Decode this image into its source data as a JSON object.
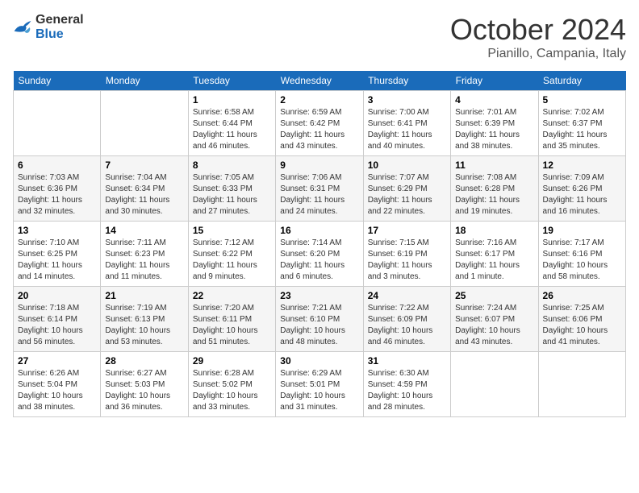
{
  "header": {
    "logo": {
      "general": "General",
      "blue": "Blue"
    },
    "title": "October 2024",
    "location": "Pianillo, Campania, Italy"
  },
  "calendar": {
    "weekdays": [
      "Sunday",
      "Monday",
      "Tuesday",
      "Wednesday",
      "Thursday",
      "Friday",
      "Saturday"
    ],
    "weeks": [
      [
        {
          "day": null
        },
        {
          "day": null
        },
        {
          "day": "1",
          "sunrise": "Sunrise: 6:58 AM",
          "sunset": "Sunset: 6:44 PM",
          "daylight": "Daylight: 11 hours and 46 minutes."
        },
        {
          "day": "2",
          "sunrise": "Sunrise: 6:59 AM",
          "sunset": "Sunset: 6:42 PM",
          "daylight": "Daylight: 11 hours and 43 minutes."
        },
        {
          "day": "3",
          "sunrise": "Sunrise: 7:00 AM",
          "sunset": "Sunset: 6:41 PM",
          "daylight": "Daylight: 11 hours and 40 minutes."
        },
        {
          "day": "4",
          "sunrise": "Sunrise: 7:01 AM",
          "sunset": "Sunset: 6:39 PM",
          "daylight": "Daylight: 11 hours and 38 minutes."
        },
        {
          "day": "5",
          "sunrise": "Sunrise: 7:02 AM",
          "sunset": "Sunset: 6:37 PM",
          "daylight": "Daylight: 11 hours and 35 minutes."
        }
      ],
      [
        {
          "day": "6",
          "sunrise": "Sunrise: 7:03 AM",
          "sunset": "Sunset: 6:36 PM",
          "daylight": "Daylight: 11 hours and 32 minutes."
        },
        {
          "day": "7",
          "sunrise": "Sunrise: 7:04 AM",
          "sunset": "Sunset: 6:34 PM",
          "daylight": "Daylight: 11 hours and 30 minutes."
        },
        {
          "day": "8",
          "sunrise": "Sunrise: 7:05 AM",
          "sunset": "Sunset: 6:33 PM",
          "daylight": "Daylight: 11 hours and 27 minutes."
        },
        {
          "day": "9",
          "sunrise": "Sunrise: 7:06 AM",
          "sunset": "Sunset: 6:31 PM",
          "daylight": "Daylight: 11 hours and 24 minutes."
        },
        {
          "day": "10",
          "sunrise": "Sunrise: 7:07 AM",
          "sunset": "Sunset: 6:29 PM",
          "daylight": "Daylight: 11 hours and 22 minutes."
        },
        {
          "day": "11",
          "sunrise": "Sunrise: 7:08 AM",
          "sunset": "Sunset: 6:28 PM",
          "daylight": "Daylight: 11 hours and 19 minutes."
        },
        {
          "day": "12",
          "sunrise": "Sunrise: 7:09 AM",
          "sunset": "Sunset: 6:26 PM",
          "daylight": "Daylight: 11 hours and 16 minutes."
        }
      ],
      [
        {
          "day": "13",
          "sunrise": "Sunrise: 7:10 AM",
          "sunset": "Sunset: 6:25 PM",
          "daylight": "Daylight: 11 hours and 14 minutes."
        },
        {
          "day": "14",
          "sunrise": "Sunrise: 7:11 AM",
          "sunset": "Sunset: 6:23 PM",
          "daylight": "Daylight: 11 hours and 11 minutes."
        },
        {
          "day": "15",
          "sunrise": "Sunrise: 7:12 AM",
          "sunset": "Sunset: 6:22 PM",
          "daylight": "Daylight: 11 hours and 9 minutes."
        },
        {
          "day": "16",
          "sunrise": "Sunrise: 7:14 AM",
          "sunset": "Sunset: 6:20 PM",
          "daylight": "Daylight: 11 hours and 6 minutes."
        },
        {
          "day": "17",
          "sunrise": "Sunrise: 7:15 AM",
          "sunset": "Sunset: 6:19 PM",
          "daylight": "Daylight: 11 hours and 3 minutes."
        },
        {
          "day": "18",
          "sunrise": "Sunrise: 7:16 AM",
          "sunset": "Sunset: 6:17 PM",
          "daylight": "Daylight: 11 hours and 1 minute."
        },
        {
          "day": "19",
          "sunrise": "Sunrise: 7:17 AM",
          "sunset": "Sunset: 6:16 PM",
          "daylight": "Daylight: 10 hours and 58 minutes."
        }
      ],
      [
        {
          "day": "20",
          "sunrise": "Sunrise: 7:18 AM",
          "sunset": "Sunset: 6:14 PM",
          "daylight": "Daylight: 10 hours and 56 minutes."
        },
        {
          "day": "21",
          "sunrise": "Sunrise: 7:19 AM",
          "sunset": "Sunset: 6:13 PM",
          "daylight": "Daylight: 10 hours and 53 minutes."
        },
        {
          "day": "22",
          "sunrise": "Sunrise: 7:20 AM",
          "sunset": "Sunset: 6:11 PM",
          "daylight": "Daylight: 10 hours and 51 minutes."
        },
        {
          "day": "23",
          "sunrise": "Sunrise: 7:21 AM",
          "sunset": "Sunset: 6:10 PM",
          "daylight": "Daylight: 10 hours and 48 minutes."
        },
        {
          "day": "24",
          "sunrise": "Sunrise: 7:22 AM",
          "sunset": "Sunset: 6:09 PM",
          "daylight": "Daylight: 10 hours and 46 minutes."
        },
        {
          "day": "25",
          "sunrise": "Sunrise: 7:24 AM",
          "sunset": "Sunset: 6:07 PM",
          "daylight": "Daylight: 10 hours and 43 minutes."
        },
        {
          "day": "26",
          "sunrise": "Sunrise: 7:25 AM",
          "sunset": "Sunset: 6:06 PM",
          "daylight": "Daylight: 10 hours and 41 minutes."
        }
      ],
      [
        {
          "day": "27",
          "sunrise": "Sunrise: 6:26 AM",
          "sunset": "Sunset: 5:04 PM",
          "daylight": "Daylight: 10 hours and 38 minutes."
        },
        {
          "day": "28",
          "sunrise": "Sunrise: 6:27 AM",
          "sunset": "Sunset: 5:03 PM",
          "daylight": "Daylight: 10 hours and 36 minutes."
        },
        {
          "day": "29",
          "sunrise": "Sunrise: 6:28 AM",
          "sunset": "Sunset: 5:02 PM",
          "daylight": "Daylight: 10 hours and 33 minutes."
        },
        {
          "day": "30",
          "sunrise": "Sunrise: 6:29 AM",
          "sunset": "Sunset: 5:01 PM",
          "daylight": "Daylight: 10 hours and 31 minutes."
        },
        {
          "day": "31",
          "sunrise": "Sunrise: 6:30 AM",
          "sunset": "Sunset: 4:59 PM",
          "daylight": "Daylight: 10 hours and 28 minutes."
        },
        {
          "day": null
        },
        {
          "day": null
        }
      ]
    ]
  }
}
